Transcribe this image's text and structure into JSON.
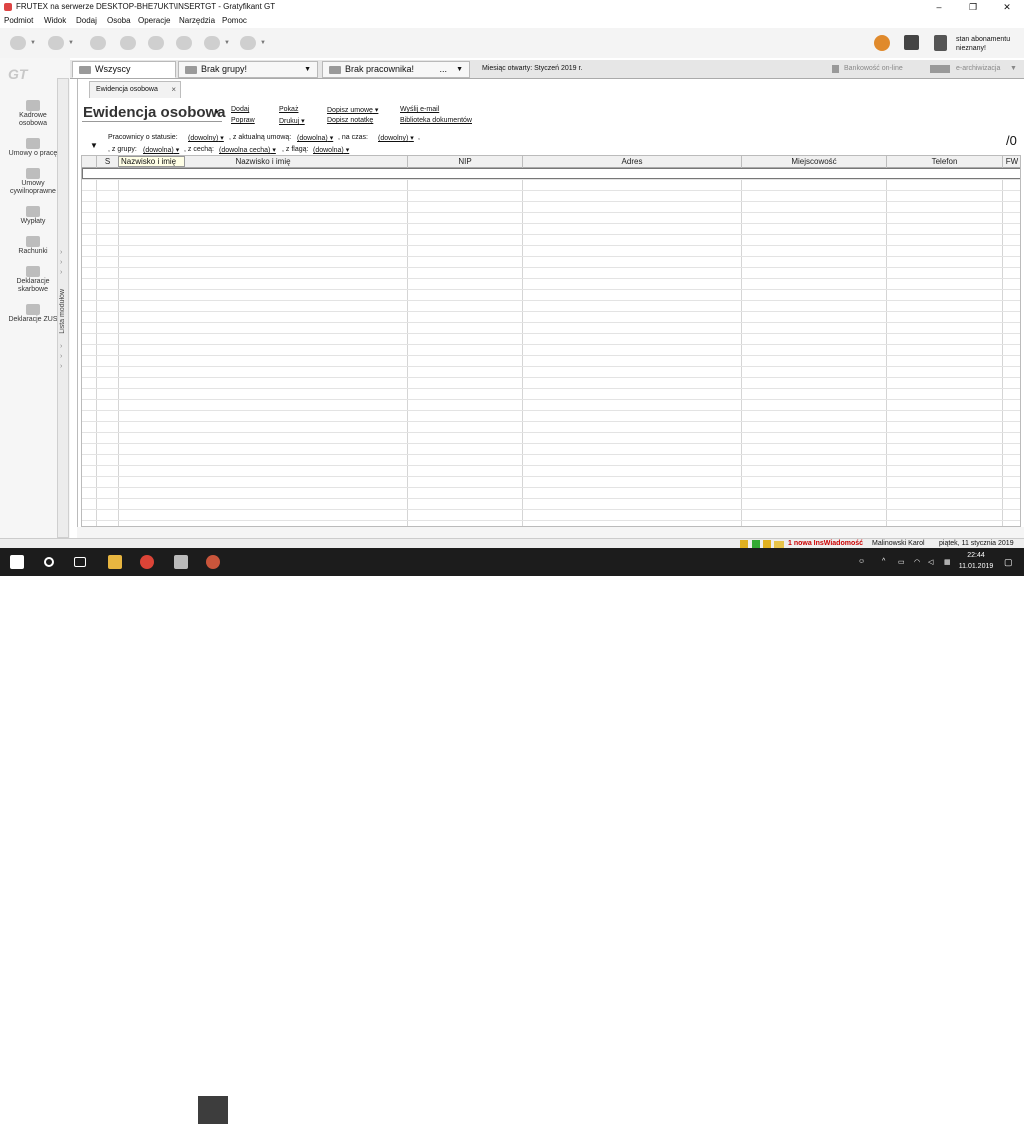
{
  "window": {
    "title": "FRUTEX na serwerze DESKTOP-BHE7UKT\\INSERTGT - Gratyfikant GT",
    "minimize": "–",
    "maximize": "❐",
    "close": "✕"
  },
  "menu": [
    "Podmiot",
    "Widok",
    "Dodaj",
    "Osoba",
    "Operacje",
    "Narzędzia",
    "Pomoc"
  ],
  "toolbar": {
    "subscription": [
      "stan abonamentu",
      "nieznany!"
    ]
  },
  "sidebar": {
    "items": [
      {
        "label": "Kadrowe osobowa",
        "lines": [
          "Kadrowe",
          "osobowa"
        ]
      },
      {
        "label": "Umowy o pracę",
        "lines": [
          "Umowy o pracę"
        ]
      },
      {
        "label": "Umowy cywilnoprawne",
        "lines": [
          "Umowy",
          "cywilnoprawne"
        ]
      },
      {
        "label": "Wypłaty",
        "lines": [
          "Wypłaty"
        ]
      },
      {
        "label": "Rachunki",
        "lines": [
          "Rachunki"
        ]
      },
      {
        "label": "Deklaracje skarbowe",
        "lines": [
          "Deklaracje",
          "skarbowe"
        ]
      },
      {
        "label": "Deklaracje ZUS",
        "lines": [
          "Deklaracje ZUS"
        ]
      }
    ],
    "lista_label": "Lista modułów"
  },
  "tabs": {
    "wszyscy": "Wszyscy",
    "brak_grupy": "Brak grupy!",
    "brak_pracownika": "Brak pracownika!",
    "brak_pracownika_more": "...",
    "miesiac": "Miesiąc otwarty: Styczeń 2019 r.",
    "bankowosc": "Bankowość on-line",
    "earchiwizacja": "e-archiwizacja"
  },
  "doc_tab": {
    "label": "Ewidencja osobowa",
    "close": "×"
  },
  "heading": "Ewidencja osobowa",
  "actions": {
    "dodaj": "Dodaj",
    "popraw": "Popraw",
    "pokaz": "Pokaż",
    "drukuj": "Drukuj",
    "dopisz_umowe": "Dopisz umowę",
    "dopisz_notatke": "Dopisz notatkę",
    "wyslij_email": "Wyślij e-mail",
    "biblioteka": "Biblioteka dokumentów"
  },
  "filters": {
    "pracownicy_label": "Pracownicy o statusie:",
    "status_value": "(dowolny)",
    "umowa_label": ", z aktualną umową:",
    "umowa_value": "(dowolna)",
    "czas_label": ", na czas:",
    "czas_value": "(dowolny)",
    "grupy_label": ", z grupy:",
    "grupy_value": "(dowolna)",
    "cecha_label": ", z cechą:",
    "cecha_value": "(dowolna cecha)",
    "flaga_label": ", z flagą:",
    "flaga_value": "(dowolna)"
  },
  "count": "/0",
  "grid": {
    "columns": [
      "S",
      "Nazwisko i imię",
      "NIP",
      "Adres",
      "Miejscowość",
      "Telefon",
      "FW"
    ],
    "tooltip": "Nazwisko i imię"
  },
  "status": {
    "wiadomosc": "1 nowa InsWiadomość",
    "user": "Malinowski Karol",
    "date": "piątek, 11 stycznia 2019"
  },
  "taskbar": {
    "time": "22:44",
    "date": "11.01.2019"
  }
}
